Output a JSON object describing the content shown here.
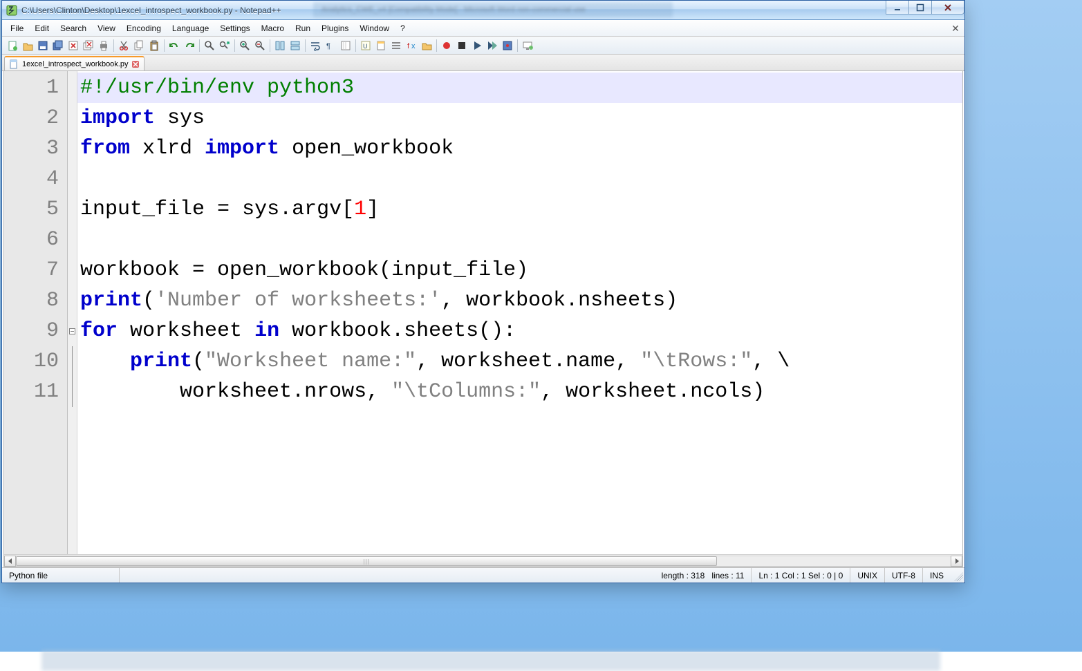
{
  "window": {
    "title": "C:\\Users\\Clinton\\Desktop\\1excel_introspect_workbook.py - Notepad++",
    "background_tab_hint": "Analytics_CWE_v4 [Compatibility Mode]  -  Microsoft Word non-commercial use"
  },
  "menus": [
    "File",
    "Edit",
    "Search",
    "View",
    "Encoding",
    "Language",
    "Settings",
    "Macro",
    "Run",
    "Plugins",
    "Window",
    "?"
  ],
  "toolbar_icons": [
    "new",
    "open",
    "save",
    "save-all",
    "close",
    "close-all",
    "print",
    "sep",
    "cut",
    "copy",
    "paste",
    "sep",
    "undo",
    "redo",
    "sep",
    "find",
    "replace",
    "sep",
    "zoom-in",
    "zoom-out",
    "sep",
    "sync-v",
    "sync-h",
    "sep",
    "wrap",
    "all-chars",
    "indent-guide",
    "sep",
    "lang-ud",
    "doc-map",
    "doc-list",
    "func-list",
    "folder",
    "sep",
    "record",
    "stop",
    "play",
    "play-multi",
    "save-macro",
    "sep",
    "monitor"
  ],
  "tab": {
    "filename": "1excel_introspect_workbook.py"
  },
  "code": {
    "lines": [
      {
        "n": 1,
        "seg": [
          {
            "t": "#!/usr/bin/env python3",
            "c": "cm"
          }
        ],
        "current": true
      },
      {
        "n": 2,
        "seg": [
          {
            "t": "import",
            "c": "kw"
          },
          {
            "t": " sys",
            "c": "id"
          }
        ]
      },
      {
        "n": 3,
        "seg": [
          {
            "t": "from",
            "c": "kw"
          },
          {
            "t": " xlrd ",
            "c": "id"
          },
          {
            "t": "import",
            "c": "kw"
          },
          {
            "t": " open_workbook",
            "c": "id"
          }
        ]
      },
      {
        "n": 4,
        "seg": [
          {
            "t": "",
            "c": "id"
          }
        ]
      },
      {
        "n": 5,
        "seg": [
          {
            "t": "input_file ",
            "c": "id"
          },
          {
            "t": "=",
            "c": "op"
          },
          {
            "t": " sys",
            "c": "id"
          },
          {
            "t": ".",
            "c": "op"
          },
          {
            "t": "argv",
            "c": "id"
          },
          {
            "t": "[",
            "c": "op"
          },
          {
            "t": "1",
            "c": "num"
          },
          {
            "t": "]",
            "c": "op"
          }
        ]
      },
      {
        "n": 6,
        "seg": [
          {
            "t": "",
            "c": "id"
          }
        ]
      },
      {
        "n": 7,
        "seg": [
          {
            "t": "workbook ",
            "c": "id"
          },
          {
            "t": "=",
            "c": "op"
          },
          {
            "t": " open_workbook",
            "c": "id"
          },
          {
            "t": "(",
            "c": "op"
          },
          {
            "t": "input_file",
            "c": "id"
          },
          {
            "t": ")",
            "c": "op"
          }
        ]
      },
      {
        "n": 8,
        "seg": [
          {
            "t": "print",
            "c": "kw"
          },
          {
            "t": "(",
            "c": "op"
          },
          {
            "t": "'Number of worksheets:'",
            "c": "str"
          },
          {
            "t": ", workbook",
            "c": "id"
          },
          {
            "t": ".",
            "c": "op"
          },
          {
            "t": "nsheets",
            "c": "id"
          },
          {
            "t": ")",
            "c": "op"
          }
        ]
      },
      {
        "n": 9,
        "seg": [
          {
            "t": "for",
            "c": "kw"
          },
          {
            "t": " worksheet ",
            "c": "id"
          },
          {
            "t": "in",
            "c": "kw"
          },
          {
            "t": " workbook",
            "c": "id"
          },
          {
            "t": ".",
            "c": "op"
          },
          {
            "t": "sheets",
            "c": "id"
          },
          {
            "t": "():",
            "c": "op"
          }
        ],
        "fold": "start"
      },
      {
        "n": 10,
        "seg": [
          {
            "t": "    ",
            "c": "id"
          },
          {
            "t": "print",
            "c": "kw"
          },
          {
            "t": "(",
            "c": "op"
          },
          {
            "t": "\"Worksheet name:\"",
            "c": "str"
          },
          {
            "t": ", worksheet",
            "c": "id"
          },
          {
            "t": ".",
            "c": "op"
          },
          {
            "t": "name",
            "c": "id"
          },
          {
            "t": ", ",
            "c": "op"
          },
          {
            "t": "\"\\tRows:\"",
            "c": "str"
          },
          {
            "t": ", ",
            "c": "op"
          },
          {
            "t": "\\",
            "c": "id"
          }
        ],
        "fold": "mid"
      },
      {
        "n": 11,
        "seg": [
          {
            "t": "        worksheet",
            "c": "id"
          },
          {
            "t": ".",
            "c": "op"
          },
          {
            "t": "nrows",
            "c": "id"
          },
          {
            "t": ", ",
            "c": "op"
          },
          {
            "t": "\"\\tColumns:\"",
            "c": "str"
          },
          {
            "t": ", worksheet",
            "c": "id"
          },
          {
            "t": ".",
            "c": "op"
          },
          {
            "t": "ncols",
            "c": "id"
          },
          {
            "t": ")",
            "c": "op"
          }
        ],
        "fold": "end"
      }
    ]
  },
  "status": {
    "filetype": "Python file",
    "length_label": "length : 318",
    "lines_label": "lines : 11",
    "pos_label": "Ln : 1    Col : 1    Sel : 0 | 0",
    "eol": "UNIX",
    "encoding": "UTF-8",
    "mode": "INS"
  }
}
